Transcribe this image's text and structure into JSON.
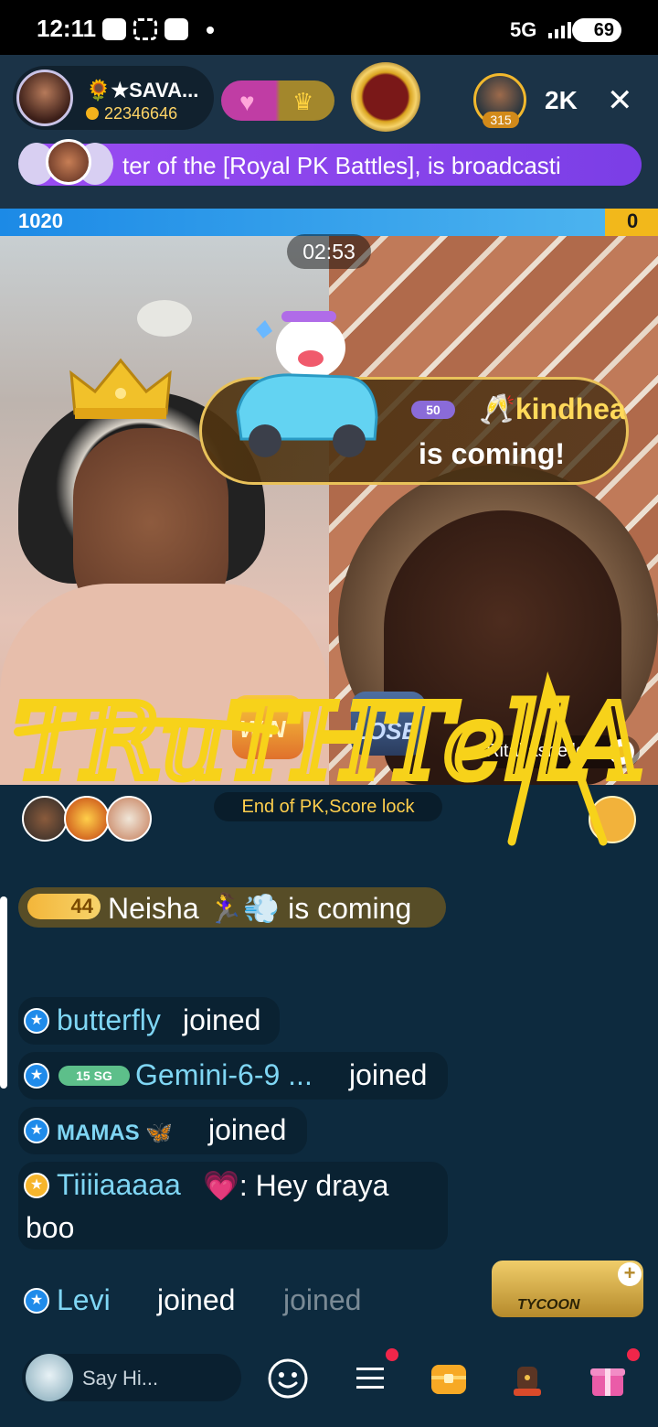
{
  "status_bar": {
    "time": "12:11",
    "network": "5G",
    "battery": "69"
  },
  "header": {
    "host_name": "🌻★SAVA...",
    "host_id": "22346646",
    "viewer_count_badge": "315",
    "viewer_total": "2K",
    "close_label": "✕"
  },
  "announcement": {
    "text": "ter of the [Royal PK Battles], is broadcasti"
  },
  "pk": {
    "left_score": "1020",
    "right_score": "0",
    "left_share": 0.92,
    "timer": "02:53",
    "win_label": "WIN",
    "lose_label": "LOSE",
    "rival_name": "Rital ashelle",
    "status": "End of PK,Score lock"
  },
  "entry_effect": {
    "vip_level": "50",
    "user": "🥂kindheart",
    "text": "is coming!"
  },
  "overlay": {
    "caption": "TRuTHTellA"
  },
  "chat": {
    "entry": {
      "level": "44",
      "user": "Neisha",
      "text": "is coming"
    },
    "messages": [
      {
        "user": "butterfly",
        "action": "joined"
      },
      {
        "level_tag": "15 SG",
        "user": "Gemini-6-9 ...",
        "action": "joined"
      },
      {
        "user": "MAMAS 🦋",
        "action": "joined"
      },
      {
        "user": "Tiiiiaaaaa",
        "text": ": Hey draya",
        "text2": "boo"
      },
      {
        "user": "Levi",
        "action": "joined",
        "faded_action": "joined"
      }
    ]
  },
  "tycoon": {
    "label": "TYCOON"
  },
  "bottom_bar": {
    "placeholder": "Say Hi..."
  },
  "icons": [
    "emoji-icon",
    "menu-icon",
    "treasure-icon",
    "fist-icon",
    "gift-icon",
    "close-icon",
    "crown-icon",
    "heart-icon"
  ],
  "colors": {
    "pk_left": "#1c8ae6",
    "pk_right": "#f2b81b",
    "banner": "#9a4cf2",
    "background": "#0d2a3e",
    "username": "#7fd6f4",
    "overlay_text": "#f7d21a"
  }
}
